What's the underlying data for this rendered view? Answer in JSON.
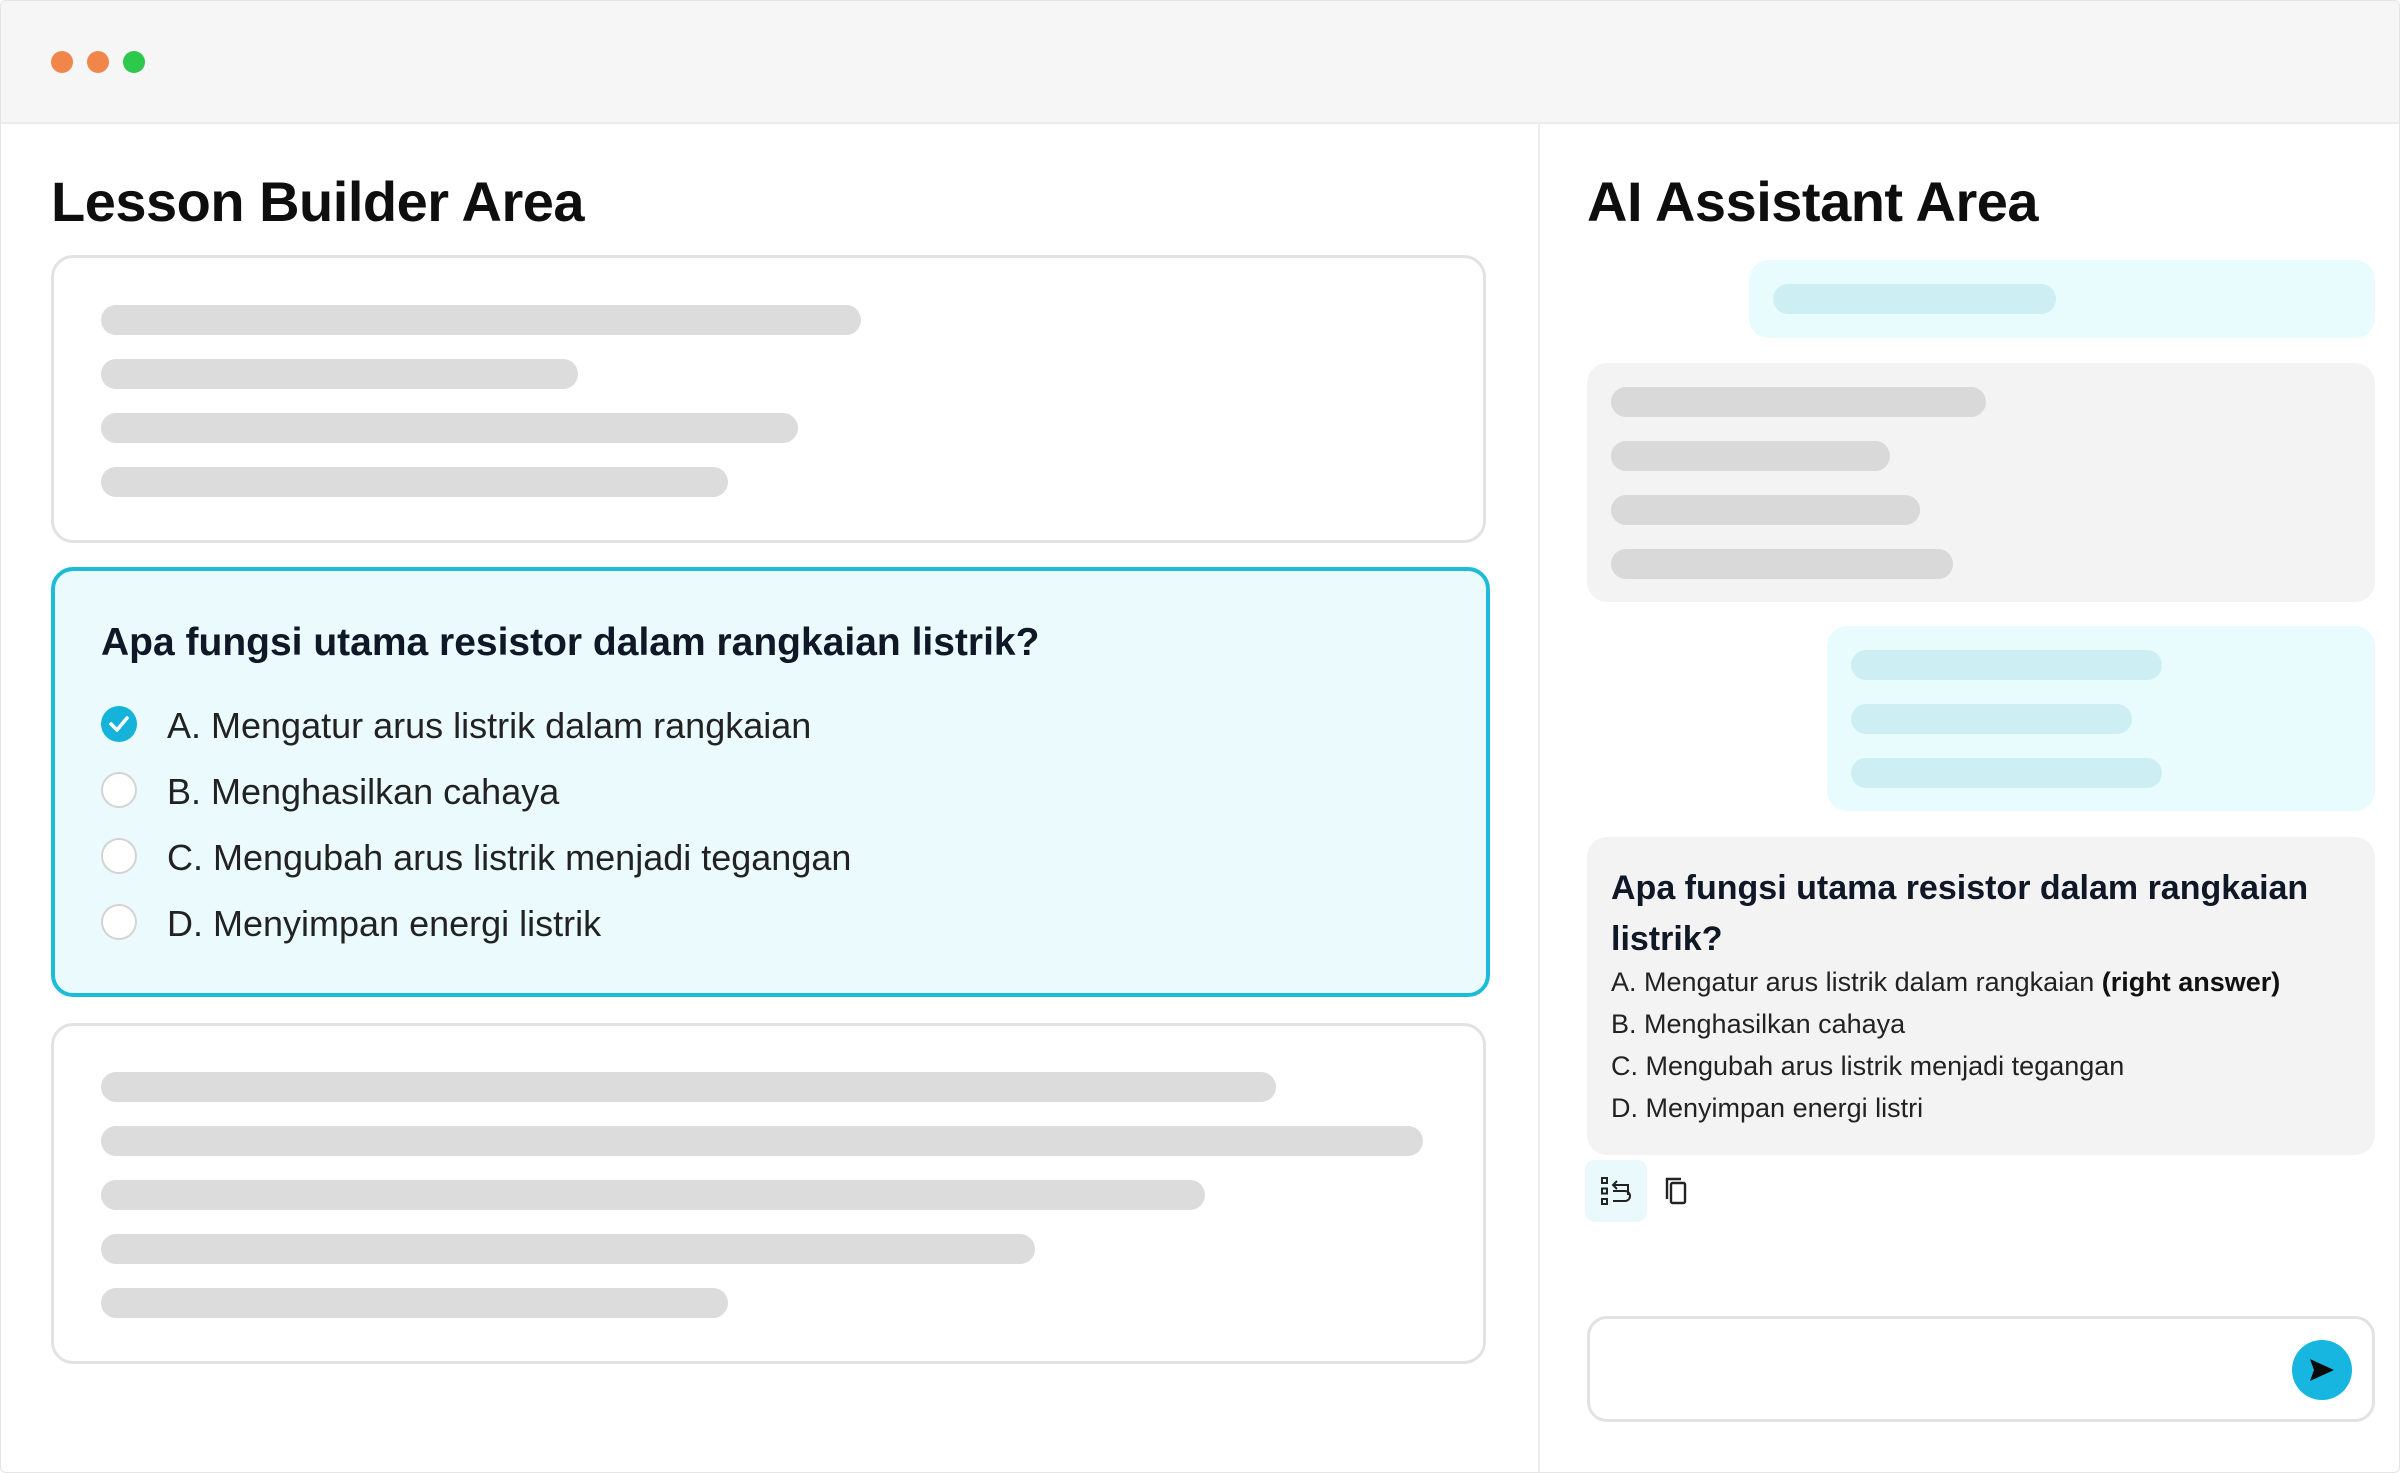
{
  "window": {
    "controls": [
      "close",
      "minimize",
      "maximize"
    ]
  },
  "lesson_builder": {
    "title": "Lesson Builder Area",
    "quiz": {
      "question": "Apa fungsi utama resistor dalam rangkaian listrik?",
      "options": [
        {
          "label": "A. Mengatur arus listrik dalam rangkaian",
          "selected": true
        },
        {
          "label": "B. Menghasilkan cahaya",
          "selected": false
        },
        {
          "label": "C. Mengubah arus listrik menjadi tegangan",
          "selected": false
        },
        {
          "label": "D. Menyimpan energi listrik",
          "selected": false
        }
      ]
    }
  },
  "ai_assistant": {
    "title": "AI Assistant Area",
    "answer": {
      "question": "Apa fungsi utama resistor dalam rangkaian listrik?",
      "option_a": "A. Mengatur arus listrik dalam rangkaian",
      "option_a_note": "(right answer)",
      "option_b": "B. Menghasilkan cahaya",
      "option_c": "C. Mengubah arus listrik menjadi tegangan",
      "option_d": "D. Menyimpan energi listri"
    },
    "actions": {
      "insert_icon": "insert-into-lesson-icon",
      "copy_icon": "copy-icon"
    },
    "input": {
      "value": "",
      "placeholder": ""
    },
    "send_icon": "send-icon"
  },
  "colors": {
    "accent": "#1cbcd9",
    "quiz_background": "#ebfbfd",
    "skeleton": "#dcdcdc",
    "user_bubble": "#e8fbfd",
    "ai_bubble": "#f3f3f3",
    "close_dot": "#f0864a",
    "min_dot": "#f0864a",
    "max_dot": "#2ec84c"
  }
}
